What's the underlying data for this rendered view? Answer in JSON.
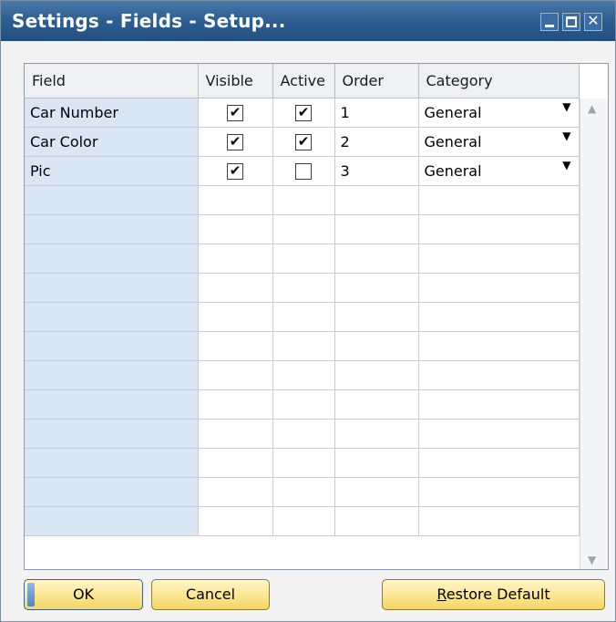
{
  "window": {
    "title": "Settings - Fields - Setup..."
  },
  "grid": {
    "columns": [
      "Field",
      "Visible",
      "Active",
      "Order",
      "Category"
    ],
    "rows": [
      {
        "field": "Car Number",
        "visible": true,
        "active": true,
        "order": "1",
        "category": "General"
      },
      {
        "field": "Car Color",
        "visible": true,
        "active": true,
        "order": "2",
        "category": "General"
      },
      {
        "field": "Pic",
        "visible": true,
        "active": false,
        "order": "3",
        "category": "General"
      }
    ],
    "empty_rows": 12
  },
  "buttons": {
    "ok": "OK",
    "cancel": "Cancel",
    "restore_default_first": "R",
    "restore_default_rest": "estore Default"
  },
  "icons": {
    "check": "✔",
    "dropdown": "▼",
    "scroll_up": "▲",
    "scroll_down": "▼",
    "close": "✕"
  },
  "colors": {
    "titlebar": "#2f5f93",
    "field_column": "#dbe6f4",
    "button_gold": "#fbe690"
  }
}
